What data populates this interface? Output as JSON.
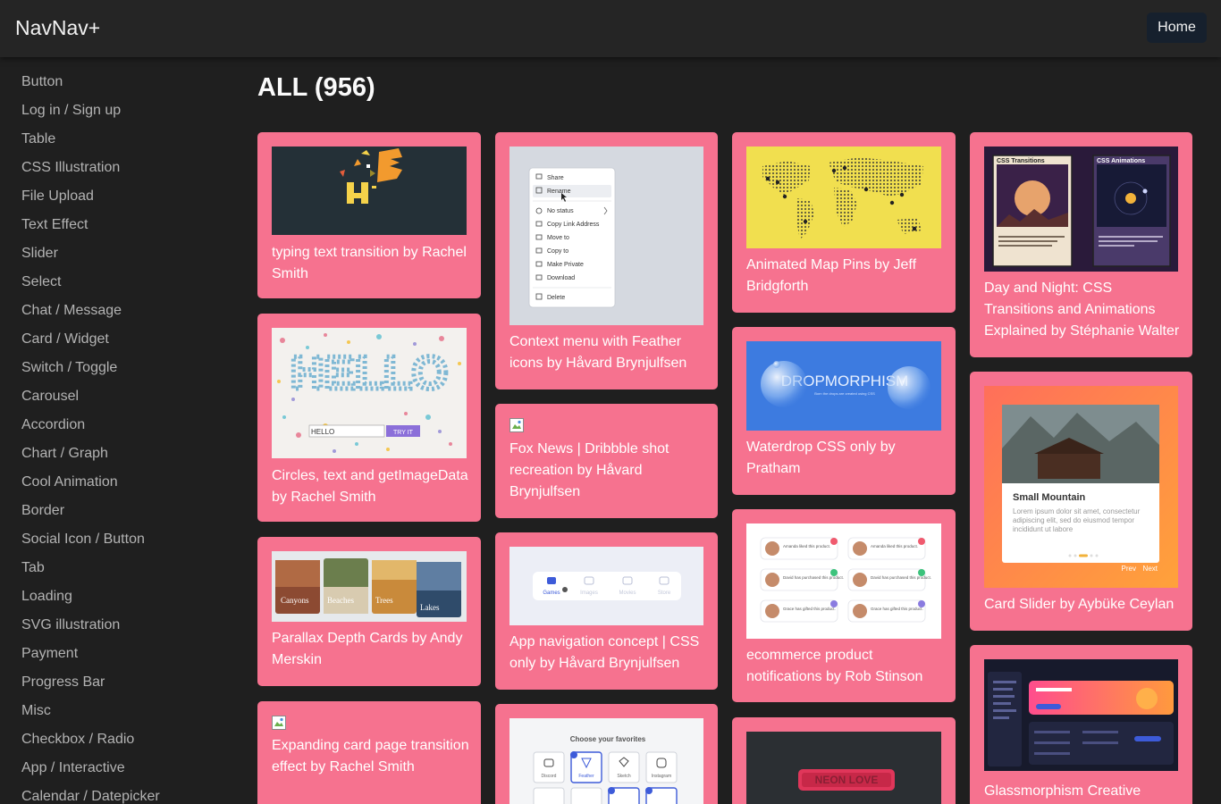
{
  "nav": {
    "brand": "NavNav+",
    "home": "Home"
  },
  "sidebar": {
    "items": [
      "Button",
      "Log in / Sign up",
      "Table",
      "CSS Illustration",
      "File Upload",
      "Text Effect",
      "Slider",
      "Select",
      "Chat / Message",
      "Card / Widget",
      "Switch / Toggle",
      "Carousel",
      "Accordion",
      "Chart / Graph",
      "Cool Animation",
      "Border",
      "Social Icon / Button",
      "Tab",
      "Loading",
      "SVG illustration",
      "Payment",
      "Progress Bar",
      "Misc",
      "Checkbox / Radio",
      "App / Interactive",
      "Calendar / Datepicker"
    ]
  },
  "main": {
    "title": "ALL (956)"
  },
  "cards": {
    "c1": "typing text transition by Rachel Smith",
    "c2": "Circles, text and getImageData by Rachel Smith",
    "c3": "Parallax Depth Cards by Andy Merskin",
    "c4": "Expanding card page transition effect by Rachel Smith",
    "c5": "Context menu with Feather icons by Håvard Brynjulfsen",
    "c6": "Fox News | Dribbble shot recreation by Håvard Brynjulfsen",
    "c7": "App navigation concept | CSS only by Håvard Brynjulfsen",
    "c9": "Animated Map Pins by Jeff Bridgforth",
    "c10": "Waterdrop CSS only by Pratham",
    "c11": "ecommerce product notifications by Rob Stinson",
    "c13": "Day and Night: CSS Transitions and Animations Explained by Stéphanie Walter",
    "c14": "Card Slider by Aybüke Ceylan",
    "c15": "Glassmorphism Creative"
  },
  "thumbs": {
    "hello_word": "HELLO",
    "hello_input": "HELLO",
    "hello_btn": "TRY IT",
    "menu": [
      "Share",
      "Rename",
      "No status",
      "Copy Link Address",
      "Move to",
      "Copy to",
      "Make Private",
      "Download",
      "Delete"
    ],
    "parallax": [
      "Canyons",
      "Beaches",
      "Trees",
      "Lakes"
    ],
    "appnav": [
      "Games",
      "Images",
      "Movies",
      "Store"
    ],
    "favorites_title": "Choose your favorites",
    "favorites": [
      "Discord",
      "Feather",
      "Sketch",
      "Instagram"
    ],
    "drop_word": "DROPMORPHISM",
    "drop_sub": "Born the drops are created using CSS",
    "notif_texts": [
      "Amanda liked this product.",
      "David has purchased this product.",
      "Grace has gifted this product."
    ],
    "neon": "NEON LOVE",
    "css_trans": "CSS Transitions",
    "css_anim": "CSS Animations",
    "slider_title": "Small Mountain",
    "slider_text": "Lorem ipsum dolor sit amet, consectetur adipiscing elit, sed do eiusmod tempor incididunt ut labore",
    "slider_prev": "Prev",
    "slider_next": "Next"
  },
  "colors": {
    "card": "#f6728f",
    "navbar": "#252525",
    "background": "#1f1f1f",
    "home_button": "#16202d"
  }
}
